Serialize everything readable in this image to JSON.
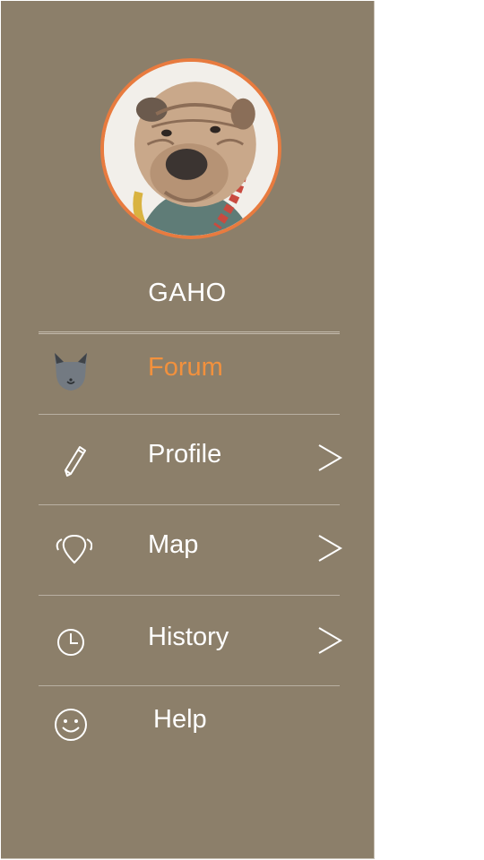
{
  "user": {
    "name": "GAHO"
  },
  "menu": [
    {
      "label": "Forum",
      "icon": "cat-icon",
      "active": true,
      "chevron": false
    },
    {
      "label": "Profile",
      "icon": "pencil-icon",
      "active": false,
      "chevron": true
    },
    {
      "label": "Map",
      "icon": "location-pin-icon",
      "active": false,
      "chevron": true
    },
    {
      "label": "History",
      "icon": "clock-icon",
      "active": false,
      "chevron": true
    },
    {
      "label": "Help",
      "icon": "smiley-icon",
      "active": false,
      "chevron": false
    }
  ],
  "colors": {
    "drawer_background": "#8c7f6a",
    "accent": "#f2913d",
    "avatar_ring": "#e87b3f",
    "text": "#ffffff"
  }
}
